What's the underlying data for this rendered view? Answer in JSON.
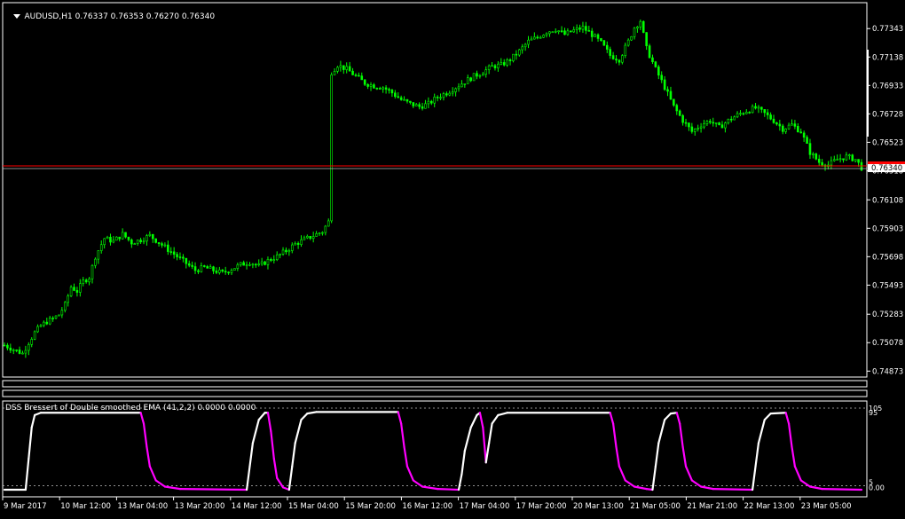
{
  "header": {
    "menu_icon": "triangle-down-icon",
    "symbol": "AUDUSD,H1",
    "ohlc": "0.76337 0.76353 0.76270 0.76340"
  },
  "indicator": {
    "label": "DSS Bressert of Double smoothed EMA (41,2,2) 0.0000 0.0000",
    "levels": [
      "105",
      "95",
      "5",
      "0.00"
    ]
  },
  "colors": {
    "background": "#000000",
    "candles": "#00ff00",
    "price_line": "#ff0000",
    "price_box": "#ff0000",
    "dss_up": "#ffffff",
    "dss_down": "#ff00ff",
    "level_lines": "#c0c0c0"
  },
  "current_price_label": "0.76340",
  "chart_data": [
    {
      "type": "candlestick",
      "symbol": "AUDUSD",
      "timeframe": "H1",
      "y_tick_labels": [
        "0.77343",
        "0.77138",
        "0.76933",
        "0.76728",
        "0.76523",
        "0.76318",
        "0.76108",
        "0.75903",
        "0.75698",
        "0.75493",
        "0.75283",
        "0.75078",
        "0.74873"
      ],
      "y_range": [
        0.7483,
        0.7753
      ],
      "x_tick_labels": [
        "9 Mar 2017",
        "10 Mar 12:00",
        "13 Mar 04:00",
        "13 Mar 20:00",
        "14 Mar 12:00",
        "15 Mar 04:00",
        "15 Mar 20:00",
        "16 Mar 12:00",
        "17 Mar 04:00",
        "17 Mar 20:00",
        "20 Mar 13:00",
        "21 Mar 05:00",
        "21 Mar 21:00",
        "22 Mar 13:00",
        "23 Mar 05:00"
      ],
      "current_price": 0.7634,
      "close_path": [
        [
          0,
          0.7506
        ],
        [
          3,
          0.7503
        ],
        [
          6,
          0.75
        ],
        [
          8,
          0.7508
        ],
        [
          10,
          0.7515
        ],
        [
          12,
          0.752
        ],
        [
          14,
          0.7523
        ],
        [
          16,
          0.7525
        ],
        [
          18,
          0.7528
        ],
        [
          20,
          0.7535
        ],
        [
          22,
          0.7548
        ],
        [
          24,
          0.7545
        ],
        [
          26,
          0.7552
        ],
        [
          28,
          0.7555
        ],
        [
          30,
          0.757
        ],
        [
          33,
          0.7583
        ],
        [
          36,
          0.7581
        ],
        [
          39,
          0.7586
        ],
        [
          42,
          0.758
        ],
        [
          45,
          0.7582
        ],
        [
          48,
          0.7585
        ],
        [
          51,
          0.758
        ],
        [
          54,
          0.7575
        ],
        [
          57,
          0.757
        ],
        [
          60,
          0.7565
        ],
        [
          63,
          0.756
        ],
        [
          66,
          0.7562
        ],
        [
          69,
          0.756
        ],
        [
          72,
          0.7558
        ],
        [
          75,
          0.7561
        ],
        [
          78,
          0.7564
        ],
        [
          81,
          0.7566
        ],
        [
          84,
          0.7563
        ],
        [
          87,
          0.7567
        ],
        [
          90,
          0.757
        ],
        [
          93,
          0.7574
        ],
        [
          96,
          0.7579
        ],
        [
          99,
          0.7582
        ],
        [
          102,
          0.7585
        ],
        [
          105,
          0.7588
        ],
        [
          107,
          0.7595
        ],
        [
          108,
          0.7703
        ],
        [
          110,
          0.7708
        ],
        [
          113,
          0.7705
        ],
        [
          116,
          0.77
        ],
        [
          119,
          0.7695
        ],
        [
          122,
          0.7693
        ],
        [
          125,
          0.7692
        ],
        [
          128,
          0.7688
        ],
        [
          131,
          0.7683
        ],
        [
          134,
          0.768
        ],
        [
          137,
          0.7678
        ],
        [
          140,
          0.768
        ],
        [
          143,
          0.7685
        ],
        [
          146,
          0.7688
        ],
        [
          149,
          0.7692
        ],
        [
          152,
          0.7696
        ],
        [
          155,
          0.77
        ],
        [
          158,
          0.7703
        ],
        [
          161,
          0.7707
        ],
        [
          164,
          0.7708
        ],
        [
          167,
          0.7712
        ],
        [
          170,
          0.7718
        ],
        [
          173,
          0.7725
        ],
        [
          176,
          0.7728
        ],
        [
          179,
          0.7732
        ],
        [
          182,
          0.7734
        ],
        [
          185,
          0.773
        ],
        [
          188,
          0.7733
        ],
        [
          191,
          0.7735
        ],
        [
          194,
          0.773
        ],
        [
          197,
          0.7724
        ],
        [
          200,
          0.7715
        ],
        [
          203,
          0.7712
        ],
        [
          206,
          0.7725
        ],
        [
          208,
          0.7735
        ],
        [
          210,
          0.774
        ],
        [
          212,
          0.772
        ],
        [
          215,
          0.7705
        ],
        [
          218,
          0.7692
        ],
        [
          221,
          0.7678
        ],
        [
          224,
          0.7668
        ],
        [
          227,
          0.766
        ],
        [
          230,
          0.7665
        ],
        [
          233,
          0.7668
        ],
        [
          236,
          0.7663
        ],
        [
          239,
          0.7668
        ],
        [
          242,
          0.7672
        ],
        [
          245,
          0.7675
        ],
        [
          248,
          0.7677
        ],
        [
          251,
          0.7673
        ],
        [
          254,
          0.7668
        ],
        [
          257,
          0.7662
        ],
        [
          260,
          0.7665
        ],
        [
          263,
          0.766
        ],
        [
          266,
          0.7645
        ],
        [
          269,
          0.7638
        ],
        [
          272,
          0.7636
        ],
        [
          275,
          0.764
        ],
        [
          278,
          0.7642
        ],
        [
          281,
          0.764
        ],
        [
          283,
          0.7634
        ]
      ]
    },
    {
      "type": "line",
      "name": "DSS Bressert of Double smoothed EMA (41,2,2)",
      "y_range": [
        0,
        105
      ],
      "levels": [
        105,
        95,
        5,
        0
      ],
      "series": [
        {
          "points": [
            [
              0,
              0
            ],
            [
              7,
              0
            ],
            [
              8,
              40
            ],
            [
              9,
              80
            ],
            [
              10,
              96
            ],
            [
              12,
              99
            ],
            [
              45,
              99
            ],
            [
              46,
              85
            ],
            [
              47,
              55
            ],
            [
              48,
              30
            ],
            [
              50,
              12
            ],
            [
              53,
              4
            ],
            [
              58,
              1
            ],
            [
              80,
              0
            ],
            [
              81,
              30
            ],
            [
              82,
              60
            ],
            [
              84,
              90
            ],
            [
              86,
              99
            ],
            [
              87,
              99
            ],
            [
              88,
              75
            ],
            [
              89,
              40
            ],
            [
              90,
              15
            ],
            [
              92,
              3
            ],
            [
              94,
              0
            ],
            [
              95,
              30
            ],
            [
              96,
              60
            ],
            [
              98,
              90
            ],
            [
              100,
              98
            ],
            [
              103,
              100
            ],
            [
              130,
              100
            ],
            [
              131,
              85
            ],
            [
              132,
              55
            ],
            [
              133,
              30
            ],
            [
              135,
              12
            ],
            [
              138,
              4
            ],
            [
              143,
              1
            ],
            [
              150,
              0
            ],
            [
              151,
              20
            ],
            [
              152,
              50
            ],
            [
              154,
              80
            ],
            [
              156,
              96
            ],
            [
              157,
              99
            ],
            [
              158,
              80
            ],
            [
              159,
              35
            ],
            [
              160,
              60
            ],
            [
              161,
              85
            ],
            [
              163,
              96
            ],
            [
              166,
              99
            ],
            [
              200,
              99
            ],
            [
              201,
              85
            ],
            [
              202,
              55
            ],
            [
              203,
              30
            ],
            [
              205,
              12
            ],
            [
              208,
              4
            ],
            [
              212,
              1
            ],
            [
              214,
              0
            ],
            [
              215,
              30
            ],
            [
              216,
              60
            ],
            [
              218,
              90
            ],
            [
              220,
              98
            ],
            [
              222,
              99
            ],
            [
              223,
              85
            ],
            [
              224,
              55
            ],
            [
              225,
              30
            ],
            [
              227,
              12
            ],
            [
              230,
              4
            ],
            [
              234,
              1
            ],
            [
              247,
              0
            ],
            [
              248,
              30
            ],
            [
              249,
              60
            ],
            [
              251,
              90
            ],
            [
              253,
              98
            ],
            [
              258,
              99
            ],
            [
              259,
              85
            ],
            [
              260,
              55
            ],
            [
              261,
              30
            ],
            [
              263,
              12
            ],
            [
              266,
              4
            ],
            [
              270,
              1
            ],
            [
              283,
              0
            ]
          ]
        }
      ]
    }
  ]
}
